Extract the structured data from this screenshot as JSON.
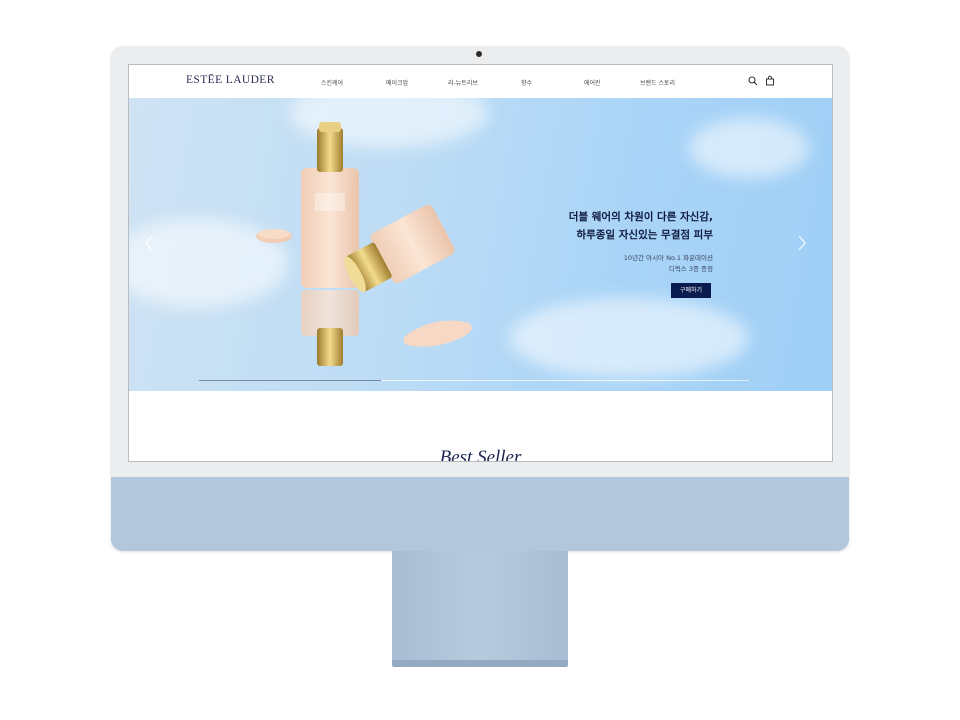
{
  "site": {
    "brand": "ESTĒE LAUDER",
    "nav": [
      "스킨케어",
      "메이크업",
      "리-뉴트리브",
      "향수",
      "에어린",
      "브랜드 스토리"
    ],
    "icons": [
      "search-icon",
      "shopping-bag-icon"
    ]
  },
  "hero": {
    "title_line1": "더블 웨어의 차원이 다른 자신감,",
    "title_line2": "하루종일 자신있는 무결점 피부",
    "sub_line1": "10년간 아시아 No.1 파운데이션",
    "sub_line2": "디럭스 3종 증정",
    "cta": "구매하기",
    "slide_progress": 0.33
  },
  "sections": {
    "best_seller_title": "Best Seller"
  },
  "colors": {
    "navy": "#0a1b4f",
    "device": "#b3c7dc"
  }
}
